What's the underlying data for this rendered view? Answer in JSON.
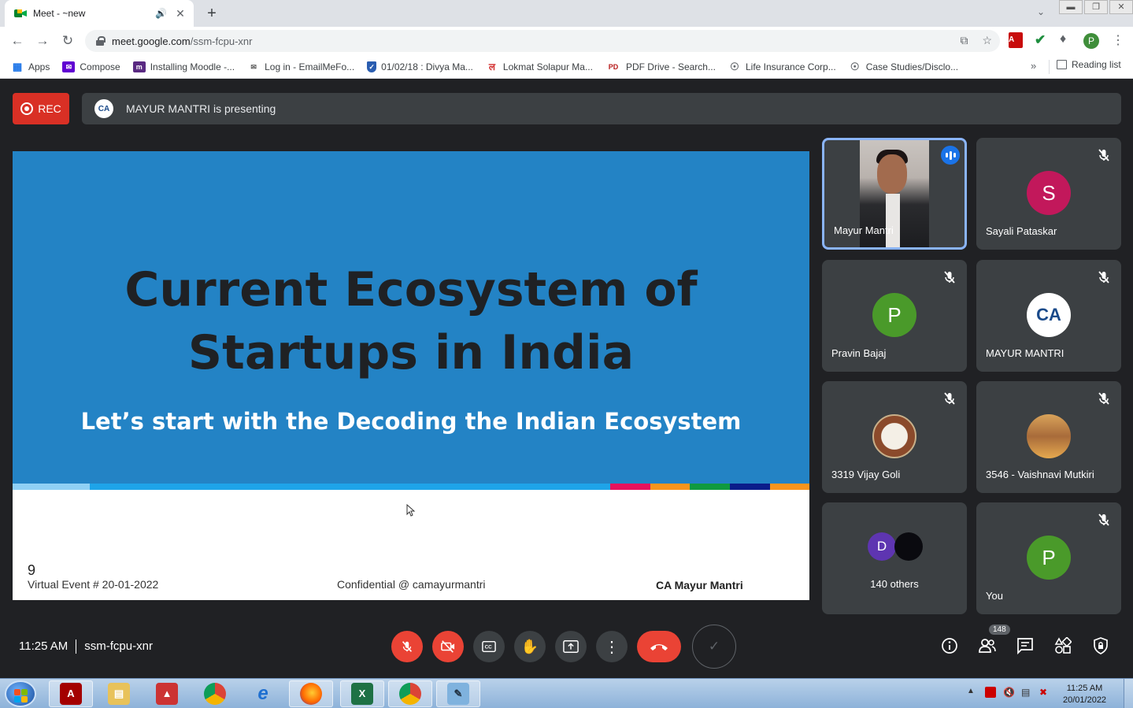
{
  "browser": {
    "tab_title": "Meet - ~new",
    "url_host": "meet.google.com",
    "url_path": "/ssm-fcpu-xnr",
    "profile_initial": "P",
    "bookmarks": [
      {
        "label": "Apps",
        "icon": "apps-grid-icon",
        "color": "#1a73e8"
      },
      {
        "label": "Compose",
        "icon": "yahoo-mail-icon",
        "color": "#6001d2"
      },
      {
        "label": "Installing Moodle -...",
        "icon": "moodle-icon",
        "color": "#5a2a82"
      },
      {
        "label": "Log in - EmailMeFo...",
        "icon": "emailmeform-icon",
        "color": "#555555"
      },
      {
        "label": "01/02/18 : Divya Ma...",
        "icon": "shield-icon",
        "color": "#2a5db0"
      },
      {
        "label": "Lokmat Solapur Ma...",
        "icon": "lokmat-icon",
        "color": "#d32f2f"
      },
      {
        "label": "PDF Drive - Search...",
        "icon": "pdfdrive-icon",
        "color": "#b71c1c"
      },
      {
        "label": "Life Insurance Corp...",
        "icon": "globe-icon",
        "color": "#5f6368"
      },
      {
        "label": "Case Studies/Disclo...",
        "icon": "globe-icon",
        "color": "#5f6368"
      }
    ],
    "reading_list": "Reading list"
  },
  "meet": {
    "rec_label": "REC",
    "presenter_text": "MAYUR MANTRI is presenting",
    "time": "11:25 AM",
    "meeting_code": "ssm-fcpu-xnr",
    "participants_count": "148",
    "accent": "#8ab4f8",
    "end_call_color": "#ea4335"
  },
  "slide": {
    "title_line1": "Current Ecosystem of",
    "title_line2": "Startups in India",
    "subtitle": "Let’s start with the Decoding the Indian Ecosystem",
    "page_number": "9",
    "footer_left": "Virtual Event # 20-01-2022",
    "footer_center": "Confidential @ camayurmantri",
    "footer_right": "CA Mayur Mantri",
    "background": "#2383c5"
  },
  "participants": [
    {
      "name": "Mayur Mantri",
      "initial": "",
      "color": "",
      "type": "video",
      "speaking": true
    },
    {
      "name": "Sayali Pataskar",
      "initial": "S",
      "color": "#c2185b",
      "type": "avatar",
      "muted": true
    },
    {
      "name": "Pravin Bajaj",
      "initial": "P",
      "color": "#4a9a2a",
      "type": "avatar",
      "muted": true
    },
    {
      "name": "MAYUR MANTRI",
      "initial": "CA",
      "color": "#ffffff",
      "type": "logo",
      "muted": true
    },
    {
      "name": "3319 Vijay Goli",
      "initial": "",
      "color": "#a0522d",
      "type": "photo",
      "muted": true
    },
    {
      "name": "3546 - Vaishnavi Mutkiri",
      "initial": "",
      "color": "#c88a3a",
      "type": "photo",
      "muted": true
    },
    {
      "name": "140 others",
      "initial": "D",
      "color": "#5e35b1",
      "type": "others"
    },
    {
      "name": "You",
      "initial": "P",
      "color": "#4a9a2a",
      "type": "avatar",
      "muted": true
    }
  ],
  "taskbar": {
    "time": "11:25 AM",
    "date": "20/01/2022"
  }
}
